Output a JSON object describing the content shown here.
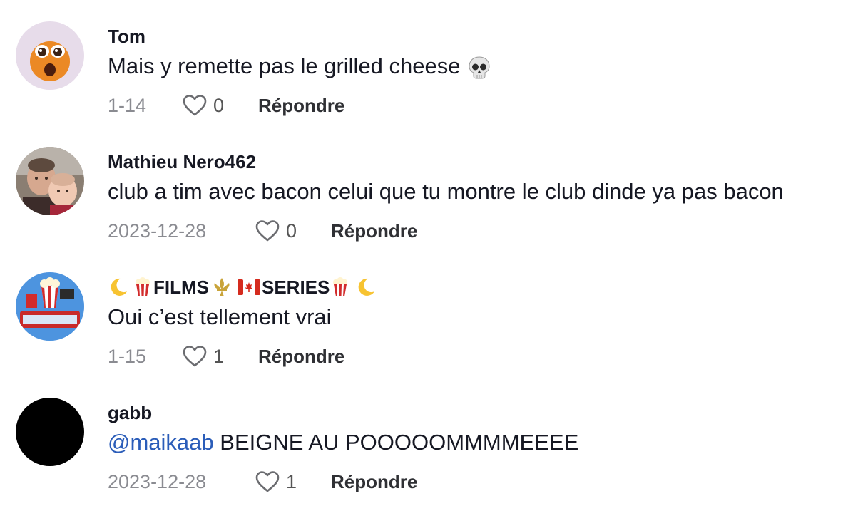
{
  "comments": [
    {
      "username": "Tom",
      "text": "Mais y remette pas le grilled cheese",
      "text_emoji": "skull",
      "date": "1-14",
      "likes": "0",
      "reply_label": "Répondre",
      "avatar": "orange-face-emoji-avatar"
    },
    {
      "username": "Mathieu Nero462",
      "text": "club a tim avec bacon celui que tu montre le club dinde ya pas bacon",
      "date": "2023-12-28",
      "likes": "0",
      "reply_label": "Répondre",
      "avatar": "photo-man-with-baby"
    },
    {
      "username_parts": [
        "FILMS",
        "SERIES"
      ],
      "username_emojis": [
        "crescent-moon",
        "popcorn",
        "fleur-de-lis",
        "canada-flag",
        "popcorn",
        "crescent-moon"
      ],
      "text": "Oui c’est tellement vrai",
      "date": "1-15",
      "likes": "1",
      "reply_label": "Répondre",
      "avatar": "popcorn-logo-avatar"
    },
    {
      "username": "gabb",
      "mention": "@maikaab",
      "text": "BEIGNE AU POOOOOMMMMEEEE",
      "date": "2023-12-28",
      "likes": "1",
      "reply_label": "Répondre",
      "avatar": "black-avatar"
    }
  ],
  "icons": {
    "like": "heart-outline-icon"
  },
  "colors": {
    "text": "#161823",
    "secondary": "#8a8b91",
    "mention": "#2b5db9",
    "background": "#ffffff"
  }
}
